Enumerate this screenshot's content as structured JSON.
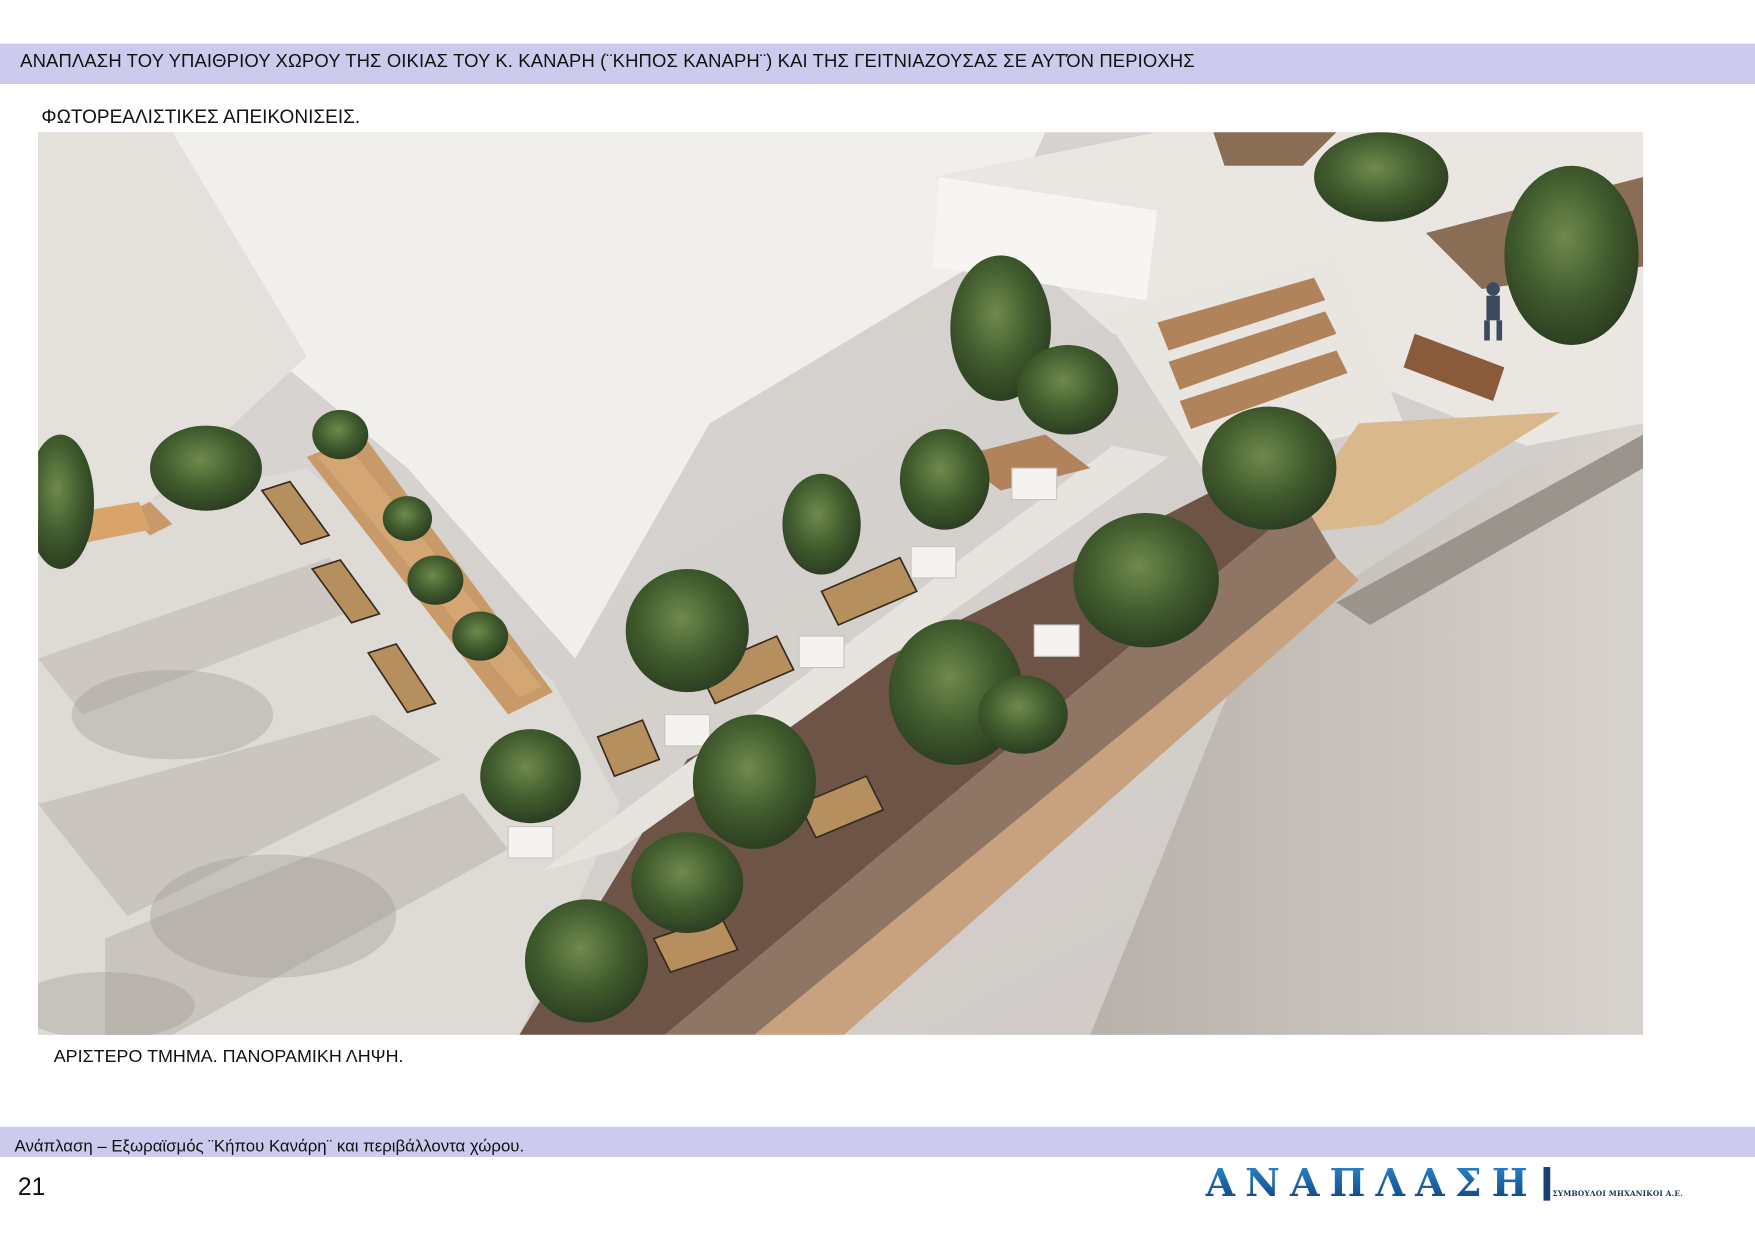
{
  "header": {
    "title": "ΑΝΑΠΛΑΣΗ ΤΟΥ ΥΠΑΙΘΡΙΟΥ ΧΩΡΟΥ ΤΗΣ ΟΙΚΙΑΣ ΤΟΥ Κ. ΚΑΝΑΡΗ (¨ΚΗΠΟΣ ΚΑΝΑΡΗ¨) ΚΑΙ ΤΗΣ ΓΕΙΤΝΙΑΖΟΥΣΑΣ ΣΕ ΑΥΤΌΝ ΠΕΡΙΟΧΗΣ",
    "band_color": "#cccbee"
  },
  "section": {
    "title": "ΦΩΤΟΡΕΑΛΙΣΤΙΚΕΣ ΑΠΕΙΚΟΝΙΣΕΙΣ."
  },
  "figure": {
    "caption": "ΑΡΙΣΤΕΡΟ ΤΜΗΜΑ.  ΠΑΝΟΡΑΜΙΚΗ ΛΗΨΗ."
  },
  "footer": {
    "text": "Ανάπλαση – Εξωραϊσμός  ¨Κήπου Κανάρη¨  και περιβάλλοντα χώρου.",
    "page_number": "21"
  },
  "logo": {
    "word": "ΑΝΑΠΛΑΣΗ",
    "subtitle": "ΣΥΜΒΟΥΛΟΙ ΜΗΧΑΝΙΚΟΙ Α.Ε.",
    "color": "#1e6fb8"
  }
}
